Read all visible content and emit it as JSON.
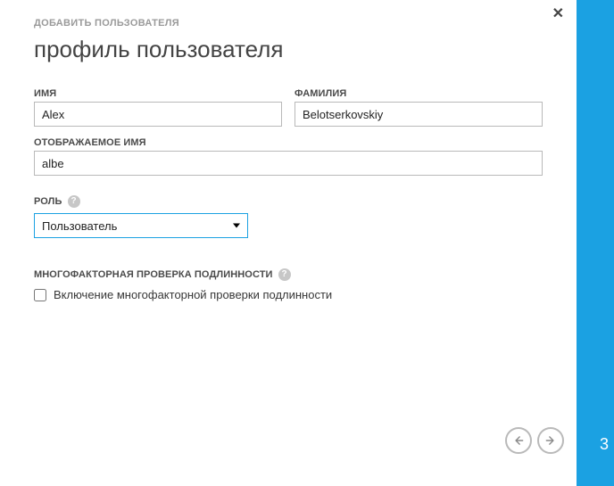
{
  "breadcrumb": "ДОБАВИТЬ ПОЛЬЗОВАТЕЛЯ",
  "title": "профиль пользователя",
  "fields": {
    "first_name": {
      "label": "ИМЯ",
      "value": "Alex"
    },
    "last_name": {
      "label": "ФАМИЛИЯ",
      "value": "Belotserkovskiy"
    },
    "display_name": {
      "label": "ОТОБРАЖАЕМОЕ ИМЯ",
      "value": "albe"
    }
  },
  "role": {
    "label": "РОЛЬ",
    "selected": "Пользователь"
  },
  "mfa": {
    "section_label": "МНОГОФАКТОРНАЯ ПРОВЕРКА ПОДЛИННОСТИ",
    "checkbox_label": "Включение многофакторной проверки подлинности",
    "checked": false
  },
  "step_number": "3"
}
